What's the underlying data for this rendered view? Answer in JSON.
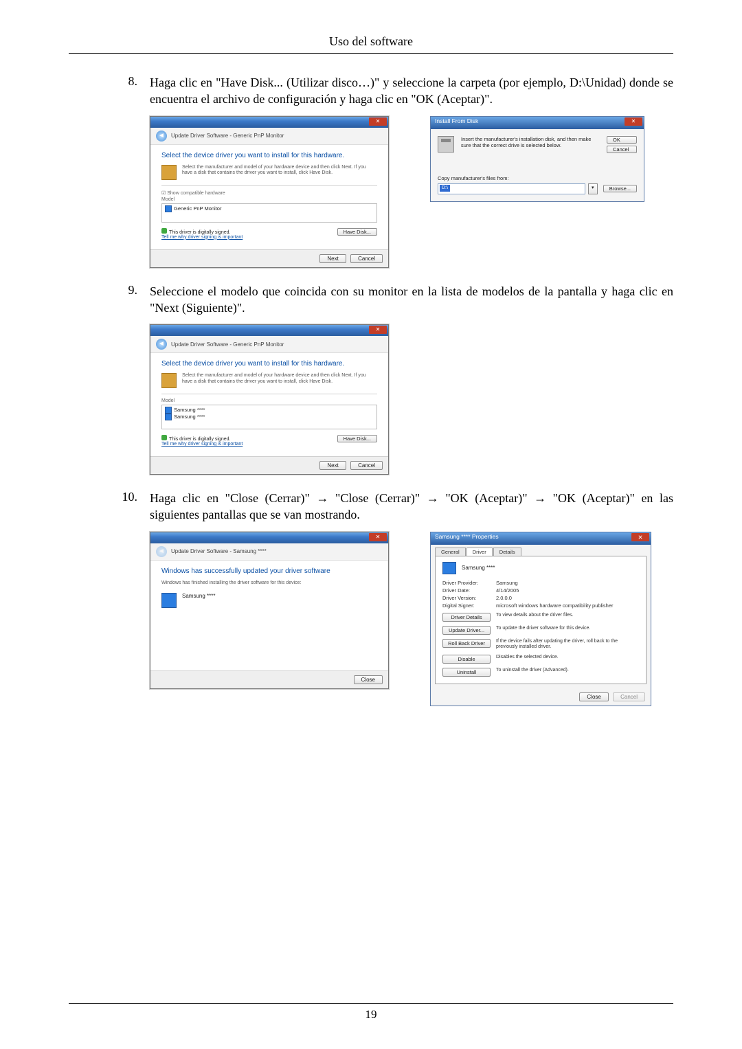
{
  "header": {
    "title": "Uso del software"
  },
  "steps": {
    "s8": {
      "num": "8.",
      "text": "Haga clic en \"Have Disk... (Utilizar disco…)\" y seleccione la carpeta (por ejemplo, D:\\Unidad) donde se encuentra el archivo de configuración y haga clic en \"OK (Aceptar)\"."
    },
    "s9": {
      "num": "9.",
      "text": "Seleccione el modelo que coincida con su monitor en la lista de modelos de la pantalla y haga clic en \"Next (Siguiente)\"."
    },
    "s10": {
      "num": "10.",
      "text": "Haga clic en \"Close (Cerrar)\" → \"Close (Cerrar)\" → \"OK (Aceptar)\" → \"OK (Aceptar)\" en las siguientes pantallas que se van mostrando."
    }
  },
  "wizard1": {
    "bread": "Update Driver Software - Generic PnP Monitor",
    "heading": "Select the device driver you want to install for this hardware.",
    "desc": "Select the manufacturer and model of your hardware device and then click Next. If you have a disk that contains the driver you want to install, click Have Disk.",
    "cb": "Show compatible hardware",
    "model_label": "Model",
    "model_item": "Generic PnP Monitor",
    "signed": "This driver is digitally signed.",
    "link": "Tell me why driver signing is important",
    "have_disk": "Have Disk...",
    "next": "Next",
    "cancel": "Cancel"
  },
  "install_disk": {
    "title": "Install From Disk",
    "msg": "Insert the manufacturer's installation disk, and then make sure that the correct drive is selected below.",
    "copy": "Copy manufacturer's files from:",
    "path": "D:\\",
    "ok": "OK",
    "cancel": "Cancel",
    "browse": "Browse..."
  },
  "wizard2": {
    "bread": "Update Driver Software - Generic PnP Monitor",
    "heading": "Select the device driver you want to install for this hardware.",
    "desc": "Select the manufacturer and model of your hardware device and then click Next. If you have a disk that contains the driver you want to install, click Have Disk.",
    "model_label": "Model",
    "model_item1": "Samsung ****",
    "model_item2": "Samsung ****",
    "signed": "This driver is digitally signed.",
    "link": "Tell me why driver signing is important",
    "have_disk": "Have Disk...",
    "next": "Next",
    "cancel": "Cancel"
  },
  "wizard3": {
    "bread": "Update Driver Software - Samsung ****",
    "heading": "Windows has successfully updated your driver software",
    "desc": "Windows has finished installing the driver software for this device:",
    "device": "Samsung ****",
    "close": "Close"
  },
  "props": {
    "title": "Samsung **** Properties",
    "tabs": {
      "general": "General",
      "driver": "Driver",
      "details": "Details"
    },
    "device": "Samsung ****",
    "kv": {
      "provider_k": "Driver Provider:",
      "provider_v": "Samsung",
      "date_k": "Driver Date:",
      "date_v": "4/14/2005",
      "version_k": "Driver Version:",
      "version_v": "2.0.0.0",
      "signer_k": "Digital Signer:",
      "signer_v": "microsoft windows hardware compatibility publisher"
    },
    "btns": {
      "details": {
        "label": "Driver Details",
        "expl": "To view details about the driver files."
      },
      "update": {
        "label": "Update Driver...",
        "expl": "To update the driver software for this device."
      },
      "rollback": {
        "label": "Roll Back Driver",
        "expl": "If the device fails after updating the driver, roll back to the previously installed driver."
      },
      "disable": {
        "label": "Disable",
        "expl": "Disables the selected device."
      },
      "uninstall": {
        "label": "Uninstall",
        "expl": "To uninstall the driver (Advanced)."
      }
    },
    "close": "Close",
    "cancel": "Cancel"
  },
  "page_number": "19"
}
